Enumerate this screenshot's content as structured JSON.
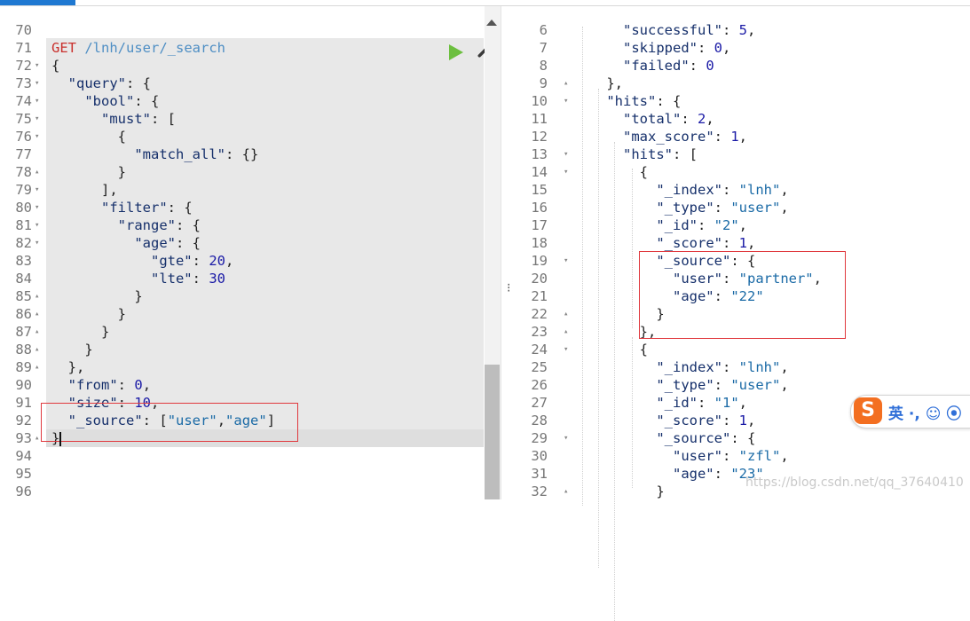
{
  "request": {
    "method": "GET",
    "path": "/lnh/user/_search",
    "line_numbers": [
      "70",
      "71",
      "72",
      "73",
      "74",
      "75",
      "76",
      "77",
      "78",
      "79",
      "80",
      "81",
      "82",
      "83",
      "84",
      "85",
      "86",
      "87",
      "88",
      "89",
      "90",
      "91",
      "92",
      "93",
      "94",
      "95",
      "96"
    ],
    "fold_lines": [
      "72",
      "73",
      "74",
      "75",
      "76",
      "78",
      "79",
      "80",
      "81",
      "82",
      "85",
      "86",
      "87",
      "88",
      "89",
      "93"
    ],
    "lines": [
      "",
      "",
      "{",
      "  \"query\": {",
      "    \"bool\": {",
      "      \"must\": [",
      "        {",
      "          \"match_all\": {}",
      "        }",
      "      ],",
      "      \"filter\": {",
      "        \"range\": {",
      "          \"age\": {",
      "            \"gte\": 20,",
      "            \"lte\": 30",
      "          }",
      "        }",
      "      }",
      "    }",
      "  },",
      "  \"from\": 0,",
      "  \"size\": 10,",
      "  \"_source\": [\"user\",\"age\"]",
      "}",
      "",
      "",
      ""
    ]
  },
  "response": {
    "line_numbers": [
      "6",
      "7",
      "8",
      "9",
      "10",
      "11",
      "12",
      "13",
      "14",
      "15",
      "16",
      "17",
      "18",
      "19",
      "20",
      "21",
      "22",
      "23",
      "24",
      "25",
      "26",
      "27",
      "28",
      "29",
      "30",
      "31",
      "32"
    ],
    "fold_lines": [
      "9",
      "10",
      "13",
      "14",
      "19",
      "22",
      "23",
      "24",
      "29",
      "32"
    ],
    "lines": [
      "      \"successful\": 5,",
      "      \"skipped\": 0,",
      "      \"failed\": 0",
      "    },",
      "    \"hits\": {",
      "      \"total\": 2,",
      "      \"max_score\": 1,",
      "      \"hits\": [",
      "        {",
      "          \"_index\": \"lnh\",",
      "          \"_type\": \"user\",",
      "          \"_id\": \"2\",",
      "          \"_score\": 1,",
      "          \"_source\": {",
      "            \"user\": \"partner\",",
      "            \"age\": \"22\"",
      "          }",
      "        },",
      "        {",
      "          \"_index\": \"lnh\",",
      "          \"_type\": \"user\",",
      "          \"_id\": \"1\",",
      "          \"_score\": 1,",
      "          \"_source\": {",
      "            \"user\": \"zfl\",",
      "            \"age\": \"23\"",
      "          }"
    ]
  },
  "ime": {
    "logo": "S",
    "label": "英 ·, ☺ ⦿"
  },
  "watermark": "https://blog.csdn.net/qq_37640410",
  "colors": {
    "method": "#c9302c",
    "path": "#4e8ec4",
    "play": "#6cbf3f",
    "highlight_box": "#e0393e"
  },
  "icons": {
    "run": "play-icon",
    "settings": "wrench-icon"
  }
}
